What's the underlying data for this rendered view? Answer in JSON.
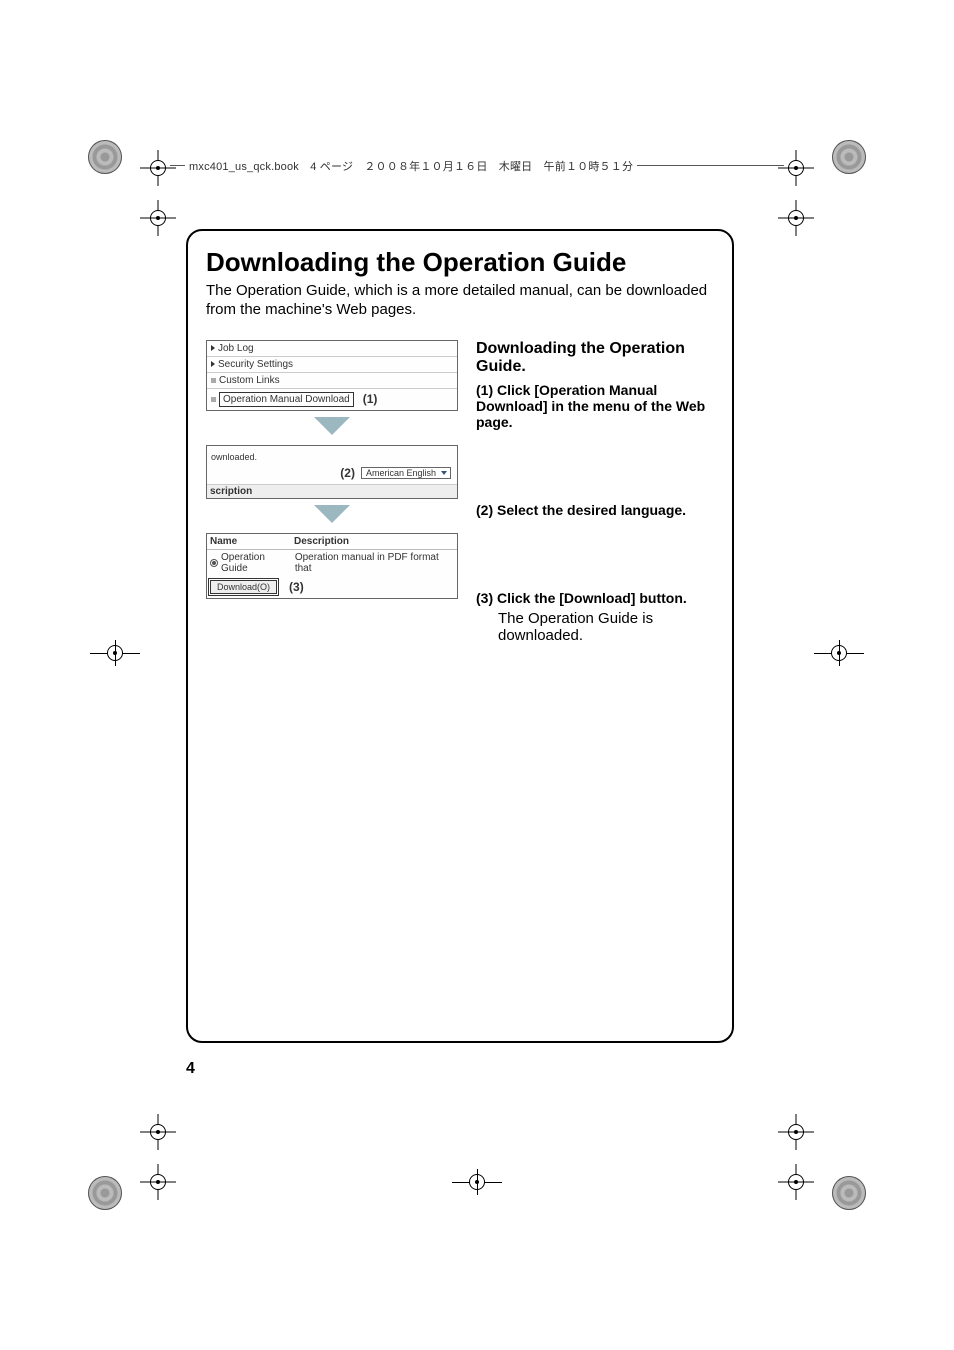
{
  "header_note": "mxc401_us_qck.book　4 ページ　２００８年１０月１６日　木曜日　午前１０時５１分",
  "title": "Downloading the Operation Guide",
  "intro": "The Operation Guide, which is a more detailed manual, can be downloaded from the machine's Web pages.",
  "ui_panel_1": {
    "job_log": "Job Log",
    "security_settings": "Security Settings",
    "custom_links": "Custom Links",
    "op_manual_download": "Operation Manual Download",
    "marker_1": "(1)"
  },
  "ui_panel_2": {
    "partial_text": "ownloaded.",
    "marker_2": "(2)",
    "language_value": "American English",
    "footer_label": "scription"
  },
  "ui_panel_3": {
    "col_name": "Name",
    "col_desc": "Description",
    "row_name": "Operation Guide",
    "row_desc": "Operation manual in PDF format that",
    "button_label": "Download(O)",
    "marker_3": "(3)"
  },
  "steps": {
    "heading": "Downloading the Operation Guide.",
    "s1_label": "(1) Click [Operation Manual Download] in the menu of the Web page.",
    "s2_label": "(2) Select the desired language.",
    "s3_label": "(3) Click the [Download] button.",
    "s3_body": "The Operation Guide is downloaded."
  },
  "page_number": "4"
}
